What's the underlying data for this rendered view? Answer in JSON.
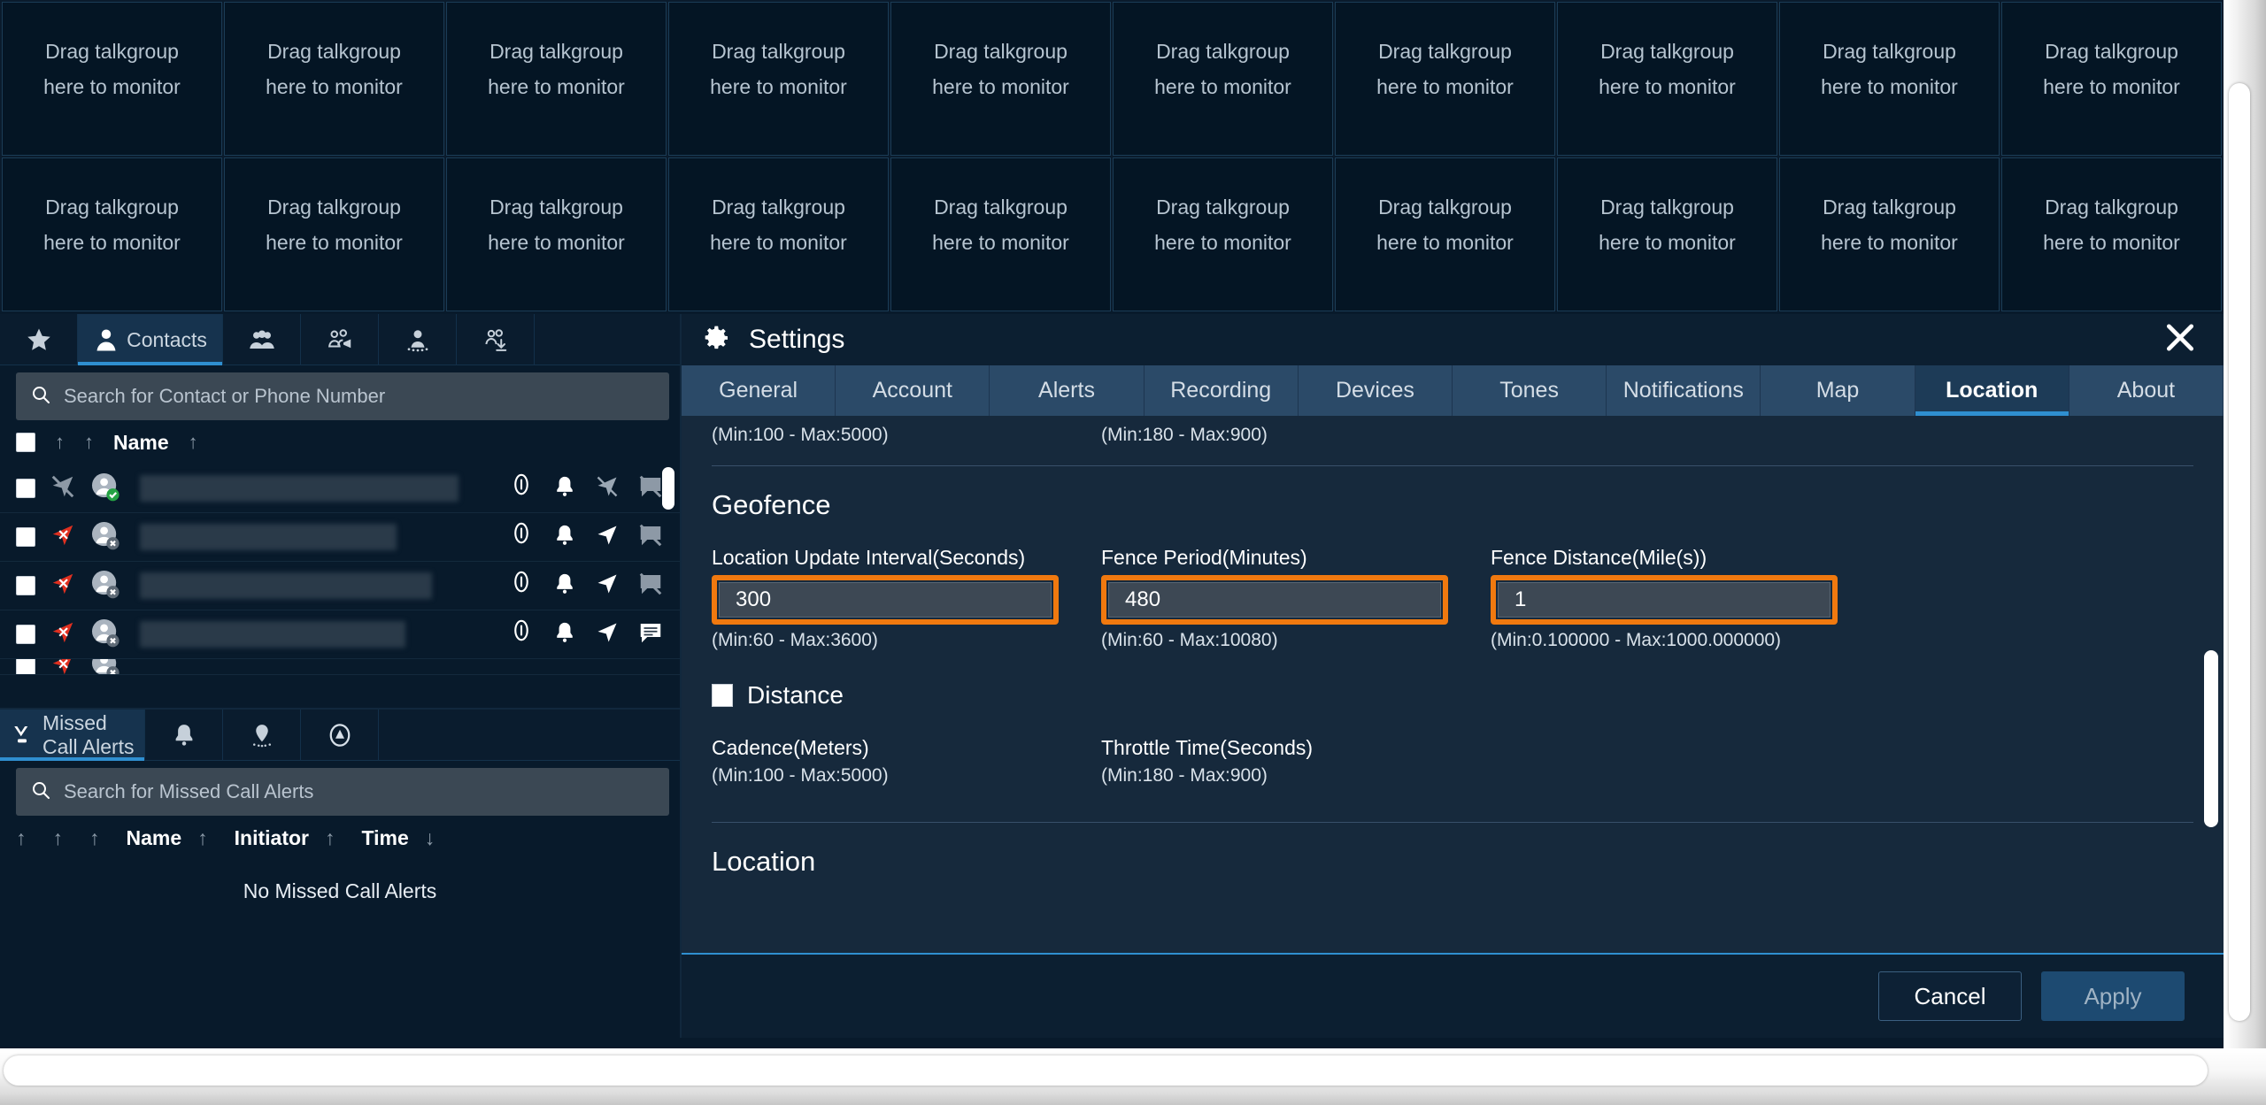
{
  "talkgroups": {
    "placeholder_line1": "Drag talkgroup",
    "placeholder_line2": "here to monitor",
    "columns": 10,
    "rows": 2
  },
  "contacts_panel": {
    "tabs": [
      {
        "label": "",
        "icon": "star-icon",
        "active": false
      },
      {
        "label": "Contacts",
        "icon": "person-icon",
        "active": true
      },
      {
        "label": "",
        "icon": "people-group-icon",
        "active": false
      },
      {
        "label": "",
        "icon": "broadcast-group-icon",
        "active": false
      },
      {
        "label": "",
        "icon": "dynamic-group-icon",
        "active": false
      },
      {
        "label": "",
        "icon": "download-group-icon",
        "active": false
      }
    ],
    "search": {
      "placeholder": "Search for Contact or Phone Number",
      "value": ""
    },
    "columns": {
      "name": "Name"
    },
    "rows": [
      {
        "presence": "available",
        "nav": "nav-off",
        "name": "",
        "message_state": "muted"
      },
      {
        "presence": "unavailable",
        "nav": "nav-on",
        "name": "",
        "message_state": "muted"
      },
      {
        "presence": "unavailable",
        "nav": "nav-on",
        "name": "",
        "message_state": "muted"
      },
      {
        "presence": "unavailable",
        "nav": "nav-on",
        "name": "",
        "message_state": "active"
      }
    ]
  },
  "missed_call_panel": {
    "tabs": [
      {
        "label": "Missed Call Alerts",
        "icon": "missed-call-icon",
        "active": true
      },
      {
        "label": "",
        "icon": "alert-bell-icon",
        "active": false
      },
      {
        "label": "",
        "icon": "geofence-pin-icon",
        "active": false
      },
      {
        "label": "",
        "icon": "emergency-icon",
        "active": false
      }
    ],
    "search": {
      "placeholder": "Search for Missed Call Alerts",
      "value": ""
    },
    "columns": {
      "name": "Name",
      "initiator": "Initiator",
      "time": "Time"
    },
    "empty_text": "No Missed Call Alerts"
  },
  "settings": {
    "title": "Settings",
    "title_icon": "gear-icon",
    "close_icon": "close-icon",
    "tabs": [
      {
        "label": "General",
        "active": false
      },
      {
        "label": "Account",
        "active": false
      },
      {
        "label": "Alerts",
        "active": false
      },
      {
        "label": "Recording",
        "active": false
      },
      {
        "label": "Devices",
        "active": false
      },
      {
        "label": "Tones",
        "active": false
      },
      {
        "label": "Notifications",
        "active": false
      },
      {
        "label": "Map",
        "active": false
      },
      {
        "label": "Location",
        "active": true
      },
      {
        "label": "About",
        "active": false
      }
    ],
    "top_hints": {
      "left": "(Min:100 - Max:5000)",
      "right": "(Min:180 - Max:900)"
    },
    "geofence": {
      "heading": "Geofence",
      "fields": [
        {
          "label": "Location Update Interval(Seconds)",
          "value": "300",
          "hint": "(Min:60 - Max:3600)",
          "highlighted": true
        },
        {
          "label": "Fence Period(Minutes)",
          "value": "480",
          "hint": "(Min:60 - Max:10080)",
          "highlighted": true
        },
        {
          "label": "Fence Distance(Mile(s))",
          "value": "1",
          "hint": "(Min:0.100000 - Max:1000.000000)",
          "highlighted": true
        }
      ]
    },
    "distance": {
      "checkbox_label": "Distance",
      "checked": false,
      "fields": [
        {
          "label": "Cadence(Meters)",
          "hint": "(Min:100 - Max:5000)"
        },
        {
          "label": "Throttle Time(Seconds)",
          "hint": "(Min:180 - Max:900)"
        }
      ]
    },
    "location_heading": "Location",
    "footer": {
      "cancel_label": "Cancel",
      "apply_label": "Apply"
    }
  },
  "colors": {
    "accent": "#2f8fd0",
    "highlight": "#f0790f",
    "panel_bg": "#16293c",
    "app_bg": "#081a2b",
    "presence_ok": "#25a244",
    "nav_active": "#e03020"
  }
}
